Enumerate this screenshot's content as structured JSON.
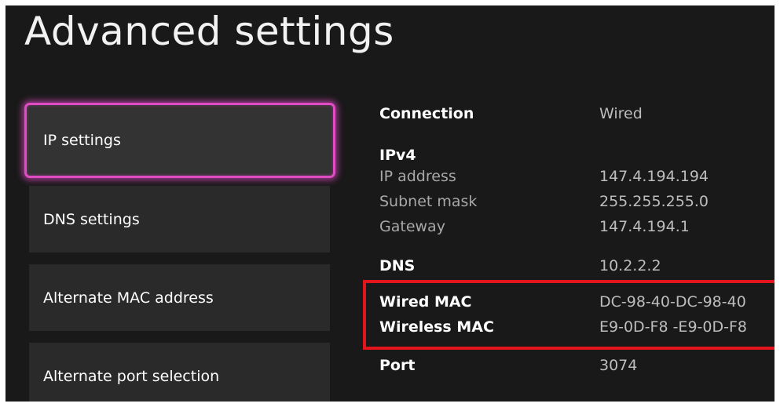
{
  "page_title": "Advanced settings",
  "menu": {
    "items": [
      {
        "label": "IP settings",
        "selected": true
      },
      {
        "label": "DNS settings",
        "selected": false
      },
      {
        "label": "Alternate MAC address",
        "selected": false
      },
      {
        "label": "Alternate port selection",
        "selected": false
      }
    ]
  },
  "details": {
    "connection": {
      "label": "Connection",
      "value": "Wired"
    },
    "ipv4": {
      "heading": "IPv4",
      "ip_address": {
        "label": "IP address",
        "value": "147.4.194.194"
      },
      "subnet_mask": {
        "label": "Subnet mask",
        "value": "255.255.255.0"
      },
      "gateway": {
        "label": "Gateway",
        "value": "147.4.194.1"
      }
    },
    "dns": {
      "label": "DNS",
      "value": "10.2.2.2"
    },
    "wired_mac": {
      "label": "Wired MAC",
      "value": "DC-98-40-DC-98-40"
    },
    "wireless_mac": {
      "label": "Wireless MAC",
      "value": "E9-0D-F8 -E9-0D-F8"
    },
    "port": {
      "label": "Port",
      "value": "3074"
    }
  },
  "colors": {
    "background": "#191919",
    "focus_glow": "#e04cc4",
    "annotation_box": "#e3141c"
  }
}
